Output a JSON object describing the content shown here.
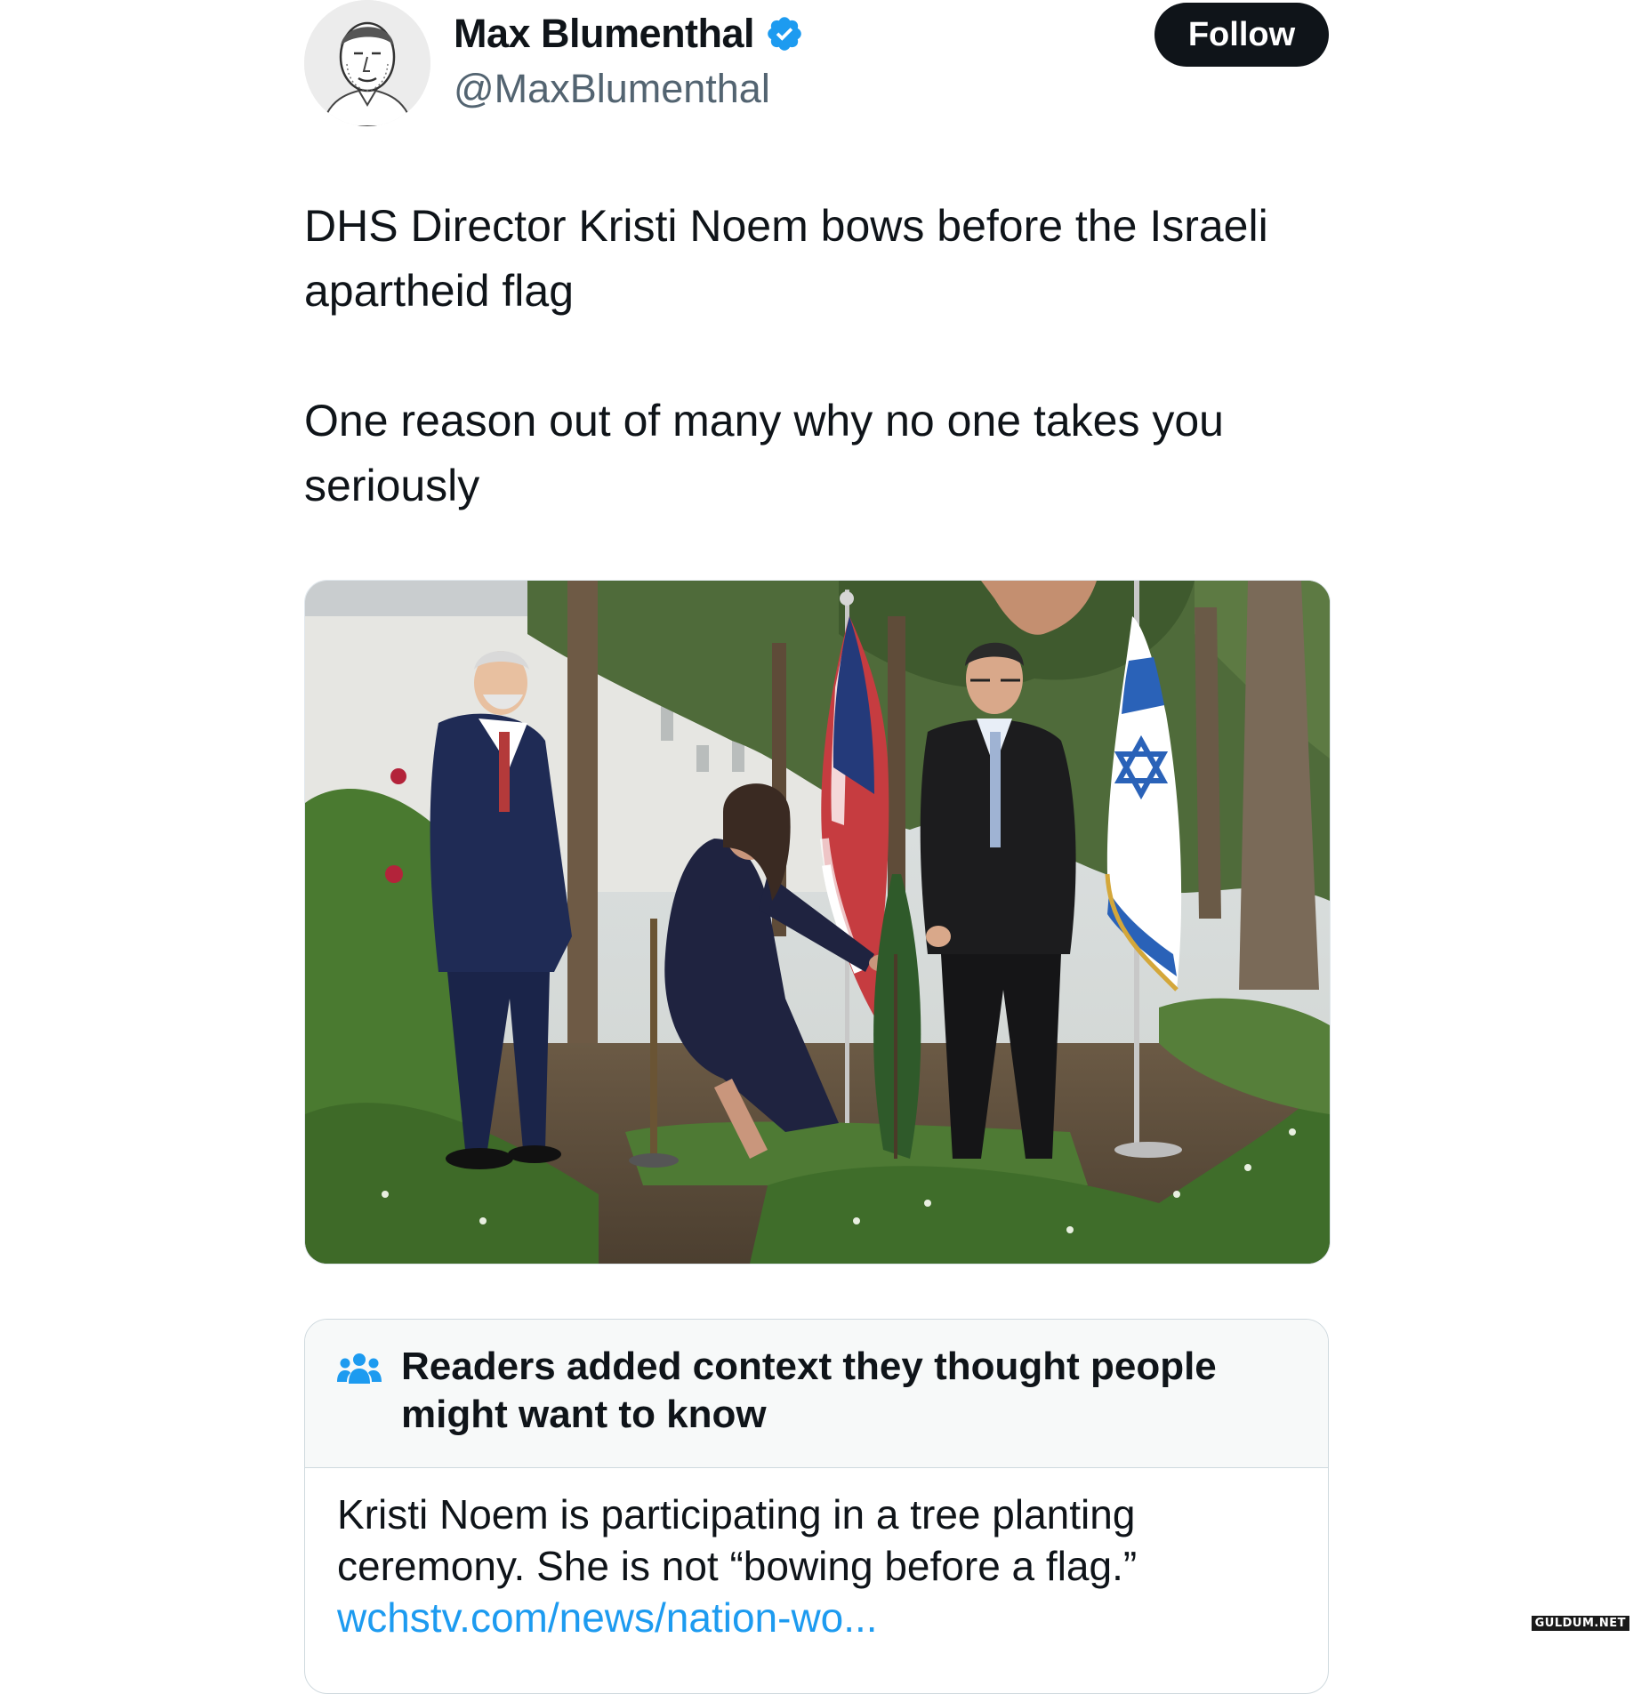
{
  "author": {
    "display_name": "Max Blumenthal",
    "handle": "@MaxBlumenthal",
    "verified_icon": "verified-badge-icon",
    "avatar_icon": "sketch-portrait-avatar"
  },
  "actions": {
    "follow_label": "Follow"
  },
  "tweet": {
    "paragraphs": [
      "DHS Director Kristi Noem bows before the Israeli apartheid flag",
      "One reason out of many why no one takes you seriously"
    ]
  },
  "media": {
    "icon": "photo-tree-planting-ceremony"
  },
  "community_note": {
    "icon": "people-icon",
    "title": "Readers added context they thought people might want to know",
    "body": "Kristi Noem is participating in a tree planting ceremony. She is not “bowing before a flag.”",
    "link": "wchstv.com/news/nation-wo..."
  },
  "watermark": "GULDUM.NET",
  "colors": {
    "accent": "#1d9bf0",
    "text_primary": "#0f1419",
    "text_secondary": "#536471",
    "follow_bg": "#0f1419",
    "note_header_bg": "#f7f9f9"
  }
}
